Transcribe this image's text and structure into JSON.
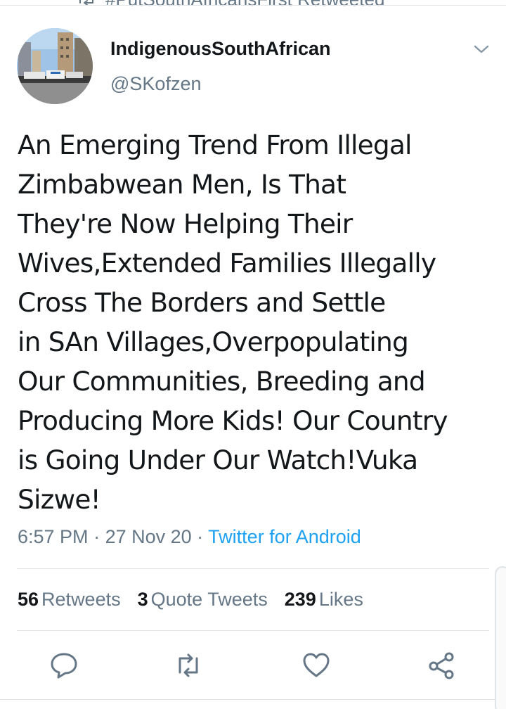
{
  "context": {
    "text": "#PutSouthAfricansFirst Retweeted"
  },
  "author": {
    "display_name": "IndigenousSouthAfrican",
    "handle": "@SKofzen"
  },
  "tweet": {
    "text": "An Emerging Trend From Illegal\nZimbabwean Men, Is That\nThey're Now Helping Their\nWives,Extended Families Illegally\nCross The Borders and Settle\nin SAn Villages,Overpopulating\nOur Communities, Breeding and\nProducing More Kids! Our Country\nis Going Under Our Watch!Vuka\nSizwe!",
    "time": "6:57 PM",
    "date": "27 Nov 20",
    "separator": " · ",
    "source": "Twitter for Android"
  },
  "stats": {
    "retweets_count": "56",
    "retweets_label": "Retweets",
    "quotes_count": "3",
    "quotes_label": "Quote Tweets",
    "likes_count": "239",
    "likes_label": "Likes"
  },
  "icons": {
    "reply": "reply-icon",
    "retweet": "retweet-icon",
    "like": "heart-icon",
    "share": "share-icon",
    "more": "chevron-down-icon"
  },
  "colors": {
    "text": "#14171a",
    "secondary": "#657786",
    "link": "#1da1f2",
    "divider": "#dfe3e6"
  }
}
